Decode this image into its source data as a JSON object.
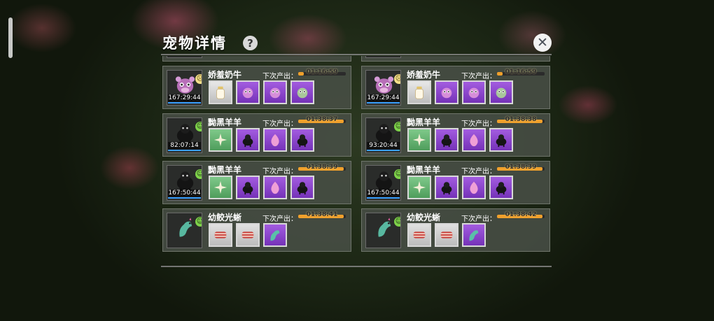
{
  "panel": {
    "title": "宠物详情",
    "help_icon": "?",
    "close_icon": "✕"
  },
  "columns": [
    {
      "cards": [
        {
          "pet": "partial-cow",
          "name": "",
          "timer": "167:29:44",
          "mood": "",
          "next_label": "",
          "progress_text": "",
          "progress": 0,
          "items": [
            "milk-bottle",
            "pink-fluff",
            "pink-fluff",
            "green-fluff"
          ]
        },
        {
          "pet": "cow",
          "name": "娇羞奶牛",
          "timer": "167:29:44",
          "mood": "sad",
          "next_label": "下次产出：",
          "progress_text": "01:16:59",
          "progress": 0.12,
          "items": [
            "milk-bottle",
            "pink-fluff",
            "pink-fluff",
            "green-fluff"
          ]
        },
        {
          "pet": "sheep",
          "name": "黝黑羊羊",
          "timer": "82:07:14",
          "mood": "happy",
          "next_label": "下次产出：",
          "progress_text": "01:38:37",
          "progress": 0.95,
          "items": [
            "wool-leaf",
            "black-sheep",
            "pink-egg",
            "black-sheep"
          ]
        },
        {
          "pet": "sheep",
          "name": "黝黑羊羊",
          "timer": "167:50:44",
          "mood": "happy",
          "next_label": "下次产出：",
          "progress_text": "01:38:39",
          "progress": 0.95,
          "items": [
            "wool-leaf",
            "black-sheep",
            "pink-egg",
            "black-sheep"
          ]
        },
        {
          "pet": "lizard",
          "name": "幼鲛光蜥",
          "timer": "",
          "mood": "happy",
          "next_label": "下次产出：",
          "progress_text": "01:38:41",
          "progress": 0.95,
          "items": [
            "meat",
            "meat",
            "lizard"
          ]
        }
      ]
    },
    {
      "cards": [
        {
          "pet": "partial-cow",
          "name": "",
          "timer": "167:29:44",
          "mood": "",
          "next_label": "",
          "progress_text": "",
          "progress": 0,
          "items": [
            "milk-bottle",
            "pink-fluff",
            "pink-fluff",
            "green-fluff"
          ]
        },
        {
          "pet": "cow",
          "name": "娇羞奶牛",
          "timer": "167:29:44",
          "mood": "sad",
          "next_label": "下次产出：",
          "progress_text": "01:16:59",
          "progress": 0.12,
          "items": [
            "milk-bottle",
            "pink-fluff",
            "pink-fluff",
            "green-fluff"
          ]
        },
        {
          "pet": "sheep",
          "name": "黝黑羊羊",
          "timer": "93:20:44",
          "mood": "happy",
          "next_label": "下次产出：",
          "progress_text": "01:38:38",
          "progress": 0.95,
          "items": [
            "wool-leaf",
            "black-sheep",
            "pink-egg",
            "black-sheep"
          ]
        },
        {
          "pet": "sheep",
          "name": "黝黑羊羊",
          "timer": "167:50:44",
          "mood": "happy",
          "next_label": "下次产出：",
          "progress_text": "01:38:39",
          "progress": 0.95,
          "items": [
            "wool-leaf",
            "black-sheep",
            "pink-egg",
            "black-sheep"
          ]
        },
        {
          "pet": "lizard",
          "name": "幼鲛光蜥",
          "timer": "",
          "mood": "happy",
          "next_label": "下次产出：",
          "progress_text": "01:38:42",
          "progress": 0.95,
          "items": [
            "meat",
            "meat",
            "lizard"
          ]
        }
      ]
    }
  ],
  "colors": {
    "progress_fill": "#f0a02c",
    "timer_underline": "#3aa0ff",
    "happy": "#7ed24a",
    "sad": "#f5e08a"
  }
}
